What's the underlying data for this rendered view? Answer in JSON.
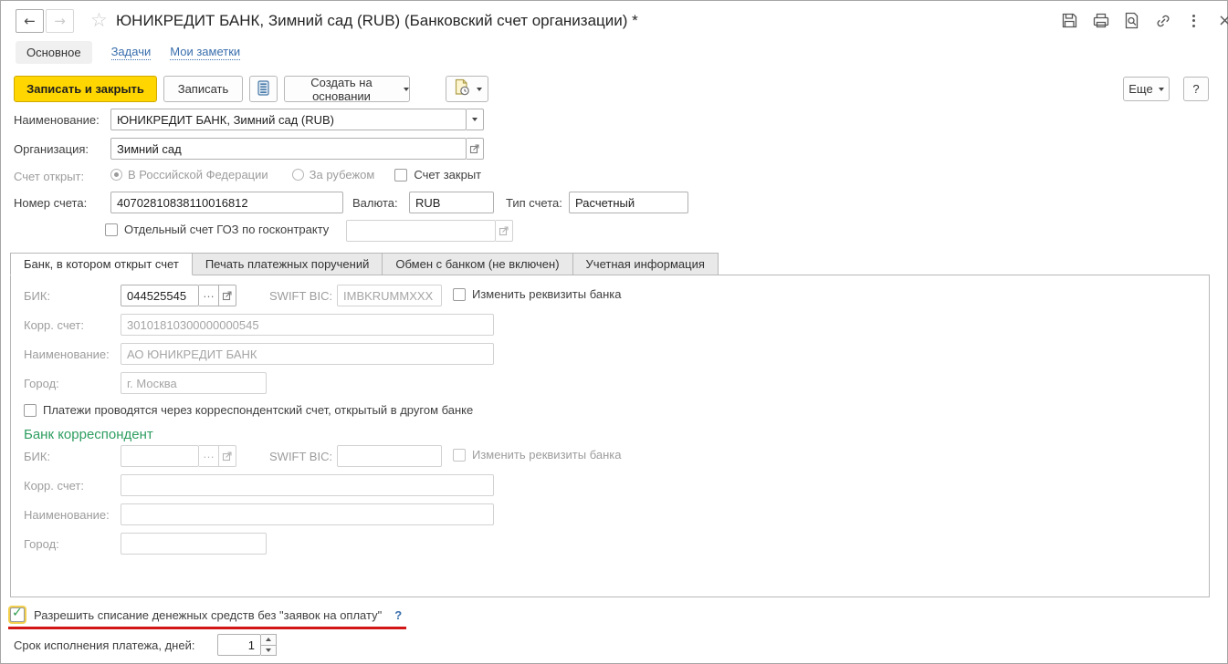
{
  "window": {
    "title": "ЮНИКРЕДИТ БАНК, Зимний сад (RUB) (Банковский счет организации) *"
  },
  "icons": {
    "back": "←",
    "forward": "→",
    "star": "☆",
    "close": "×",
    "check": "✓"
  },
  "nav": {
    "main": "Основное",
    "tasks": "Задачи",
    "notes": "Мои заметки"
  },
  "toolbar": {
    "save_and_close": "Записать и закрыть",
    "save": "Записать",
    "create_based_on": "Создать на основании",
    "more": "Еще",
    "help": "?"
  },
  "form": {
    "name_label": "Наименование:",
    "name_value": "ЮНИКРЕДИТ БАНК, Зимний сад (RUB)",
    "org_label": "Организация:",
    "org_value": "Зимний сад",
    "opened_label": "Счет открыт:",
    "opened_rf": "В Российской Федерации",
    "opened_abroad": "За рубежом",
    "closed": "Счет закрыт",
    "number_label": "Номер счета:",
    "number_value": "40702810838110016812",
    "currency_label": "Валюта:",
    "currency_value": "RUB",
    "type_label": "Тип счета:",
    "type_value": "Расчетный",
    "goz": "Отдельный счет ГОЗ по госконтракту"
  },
  "tabstrip": {
    "bank": "Банк, в котором открыт счет",
    "print": "Печать платежных поручений",
    "exchange": "Обмен с банком (не включен)",
    "accounting": "Учетная информация"
  },
  "bank": {
    "bik_label": "БИК:",
    "bik_value": "044525545",
    "dots": "…",
    "swift_label": "SWIFT BIC:",
    "swift_value": "IMBKRUMMXXX",
    "edit": "Изменить реквизиты банка",
    "corr_label": "Корр. счет:",
    "corr_value": "30101810300000000545",
    "name_label": "Наименование:",
    "name_value": "АО ЮНИКРЕДИТ БАНК",
    "city_label": "Город:",
    "city_value": "г. Москва",
    "via_corr": "Платежи проводятся через корреспондентский счет, открытый в другом банке"
  },
  "corr_bank": {
    "header": "Банк корреспондент",
    "bik_label": "БИК:",
    "dots": "…",
    "swift_label": "SWIFT BIC:",
    "edit": "Изменить реквизиты банка",
    "corr_label": "Корр. счет:",
    "name_label": "Наименование:",
    "city_label": "Город:"
  },
  "footer": {
    "allow_writeoff": "Разрешить списание денежных средств без \"заявок на оплату\"",
    "help": "?",
    "term_label": "Срок исполнения платежа, дней:",
    "term_value": "1"
  },
  "colors": {
    "accent_yellow": "#ffd600",
    "link_blue": "#3a6fad",
    "section_green": "#2e9e60",
    "attention_red": "#d21616",
    "check_green": "#2f9e4f"
  }
}
